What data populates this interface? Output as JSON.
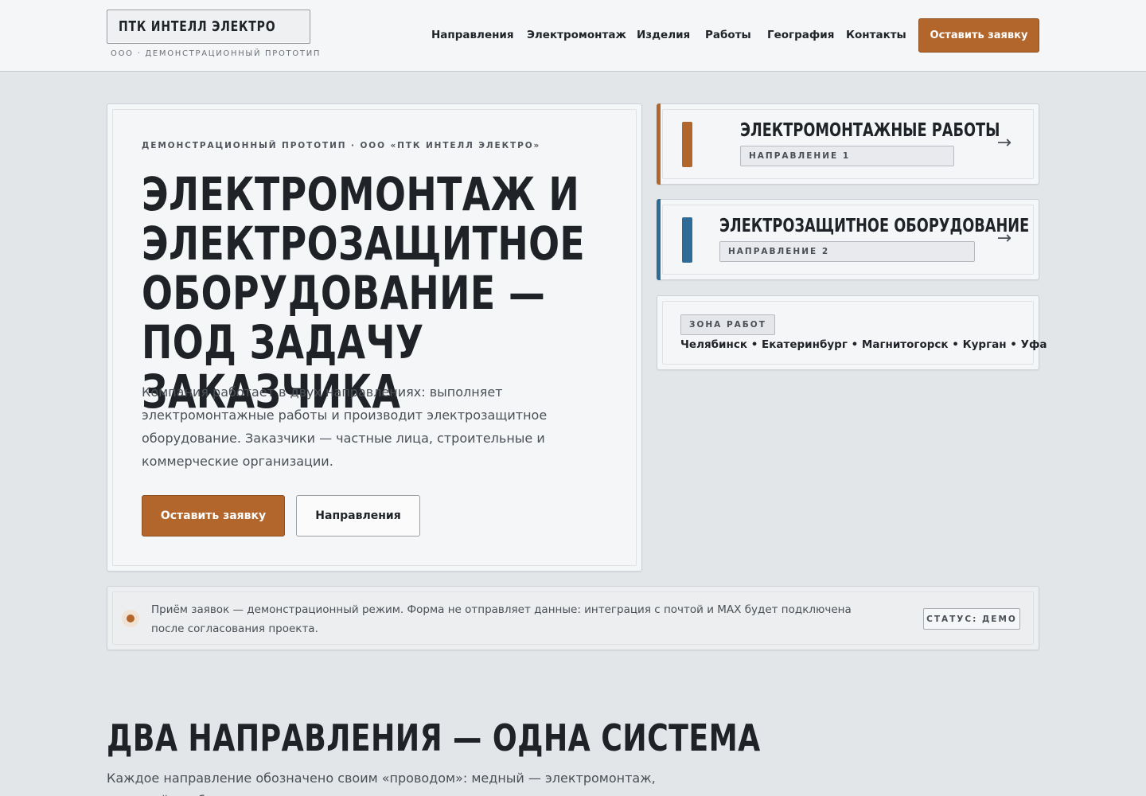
{
  "header": {
    "logo": "ПТК ИНТЕЛЛ ЭЛЕКТРО",
    "logo_sub": "ООО · ДЕМОНСТРАЦИОННЫЙ ПРОТОТИП",
    "nav": [
      "Направления",
      "Электромонтаж",
      "Изделия",
      "Работы",
      "География",
      "Контакты"
    ],
    "cta": "Оставить заявку"
  },
  "hero": {
    "eyebrow": "ДЕМОНСТРАЦИОННЫЙ ПРОТОТИП · ООО «ПТК ИНТЕЛЛ ЭЛЕКТРО»",
    "title": "ЭЛЕКТРОМОНТАЖ И ЭЛЕКТРОЗАЩИТНОЕ ОБОРУДОВАНИЕ — ПОД ЗАДАЧУ ЗАКАЗЧИКА",
    "description": "Компания работает в двух направлениях: выполняет электромонтажные работы и производит электрозащитное оборудование. Заказчики — частные лица, строительные и коммерческие организации.",
    "primary_button": "Оставить заявку",
    "secondary_button": "Направления"
  },
  "directions": [
    {
      "title": "ЭЛЕКТРОМОНТАЖНЫЕ РАБОТЫ",
      "tag": "НАПРАВЛЕНИЕ 1",
      "color": "#b2662b",
      "arrow": "→"
    },
    {
      "title": "ЭЛЕКТРОЗАЩИТНОЕ ОБОРУДОВАНИЕ",
      "tag": "НАПРАВЛЕНИЕ 2",
      "color": "#2e6b96",
      "arrow": "→"
    }
  ],
  "zone": {
    "tag": "ЗОНА РАБОТ",
    "cities": "Челябинск • Екатеринбург • Магнитогорск • Курган • Уфа"
  },
  "notice": {
    "text": "Приём заявок — демонстрационный режим. Форма не отправляет данные: интеграция с почтой и MAX будет подключена после согласования проекта.",
    "status": "СТАТУС: ДЕМО"
  },
  "section": {
    "title": "ДВА НАПРАВЛЕНИЯ — ОДНА СИСТЕМА",
    "description": "Каждое направление обозначено своим «проводом»: медный — электромонтаж, стальной — оборудование."
  },
  "colors": {
    "accent_copper": "#b2662b",
    "accent_steel": "#2e6b96",
    "background": "#e3e6e9"
  }
}
